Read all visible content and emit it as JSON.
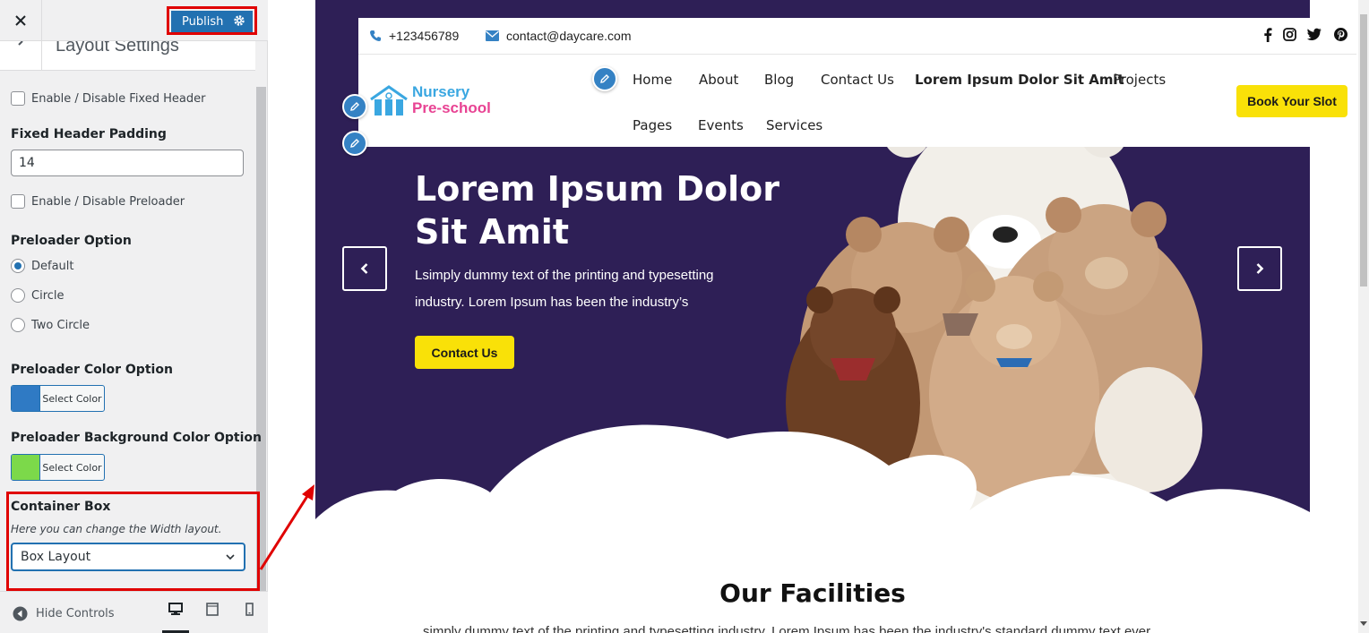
{
  "panel": {
    "publish_label": "Publish",
    "section_title": "Layout Settings",
    "fixed_header_toggle": "Enable / Disable Fixed Header",
    "fixed_header_padding_label": "Fixed Header Padding",
    "fixed_header_padding_value": "14",
    "preloader_toggle": "Enable / Disable Preloader",
    "preloader_option_label": "Preloader Option",
    "preloader_options": [
      "Default",
      "Circle",
      "Two Circle"
    ],
    "preloader_selected": "Default",
    "preloader_color_label": "Preloader Color Option",
    "preloader_color_button": "Select Color",
    "preloader_color": "#2f7ac4",
    "preloader_bg_label": "Preloader Background Color Option",
    "preloader_bg_button": "Select Color",
    "preloader_bg_color": "#7cd94a",
    "container_box_label": "Container Box",
    "container_box_desc": "Here you can change the Width layout.",
    "container_box_value": "Box Layout",
    "hide_controls": "Hide Controls"
  },
  "site": {
    "phone": "+123456789",
    "email": "contact@daycare.com",
    "logo_line1": "Nursery",
    "logo_line2": "Pre-school",
    "nav": {
      "home": "Home",
      "about": "About",
      "blog": "Blog",
      "contact": "Contact Us",
      "lorem": "Lorem Ipsum Dolor Sit Amit",
      "projects": "Projects",
      "pages": "Pages",
      "events": "Events",
      "services": "Services"
    },
    "book_button": "Book Your Slot",
    "hero_title": "Lorem Ipsum Dolor Sit Amit",
    "hero_text": "Lsimply dummy text of the printing and typesetting industry. Lorem Ipsum has been the industry’s",
    "hero_cta": "Contact Us",
    "facilities_title": "Our Facilities",
    "facilities_text": "simply dummy text of the printing and typesetting industry. Lorem Ipsum has been the industry's standard dummy text ever"
  },
  "colors": {
    "wp_blue": "#2271b1",
    "hero_bg": "#2e1f56",
    "accent_yellow": "#f9e108",
    "highlight_red": "#e00000"
  },
  "icons": {
    "close": "close-icon",
    "gear": "gear-icon",
    "phone": "phone-icon",
    "email": "envelope-icon",
    "social": [
      "facebook-icon",
      "instagram-icon",
      "twitter-icon",
      "pinterest-icon"
    ],
    "edit": "pencil-icon"
  }
}
